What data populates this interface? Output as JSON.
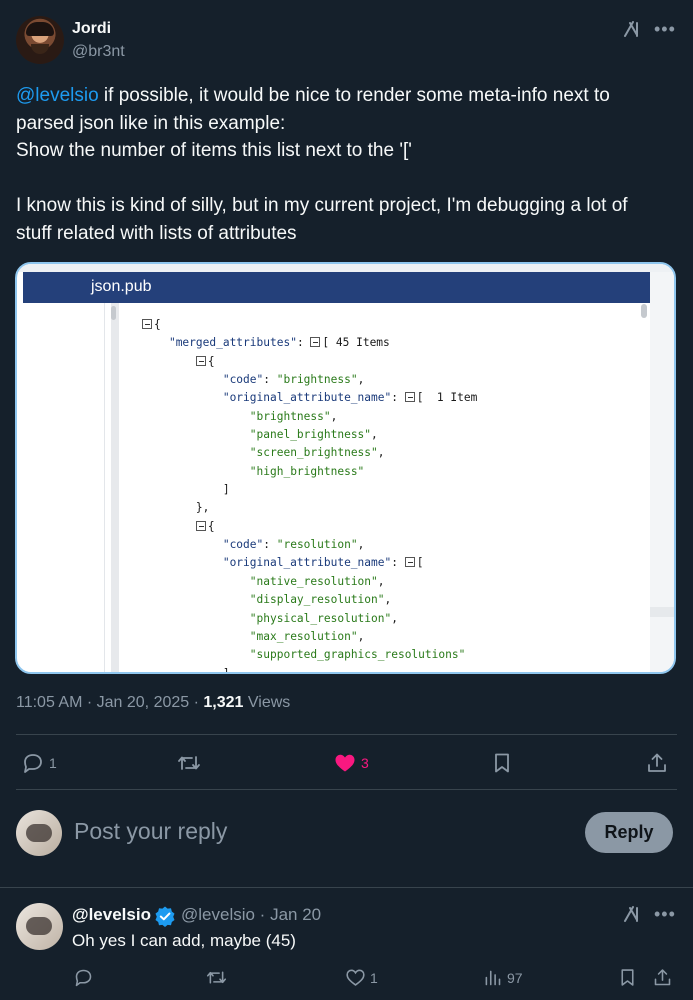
{
  "tweet": {
    "author_name": "Jordi",
    "author_handle": "@br3nt",
    "text": {
      "mention": "@levelsio",
      "line1_rest": " if possible, it would be nice to render some meta-info next to",
      "line2": "parsed json like in this example:",
      "line3": "Show the number of items this list next to the '['",
      "line4": "I know this is kind of silly, but in my current project, I'm debugging a lot of",
      "line5": "stuff related with lists of attributes"
    },
    "media": {
      "header_title": "json.pub",
      "code": {
        "open_brace": "{",
        "merged_key": "\"merged_attributes\"",
        "merged_meta": "[ 45 Items",
        "item1_open": "{",
        "code_key": "\"code\"",
        "code1_value": "\"brightness\"",
        "orig_key": "\"original_attribute_name\"",
        "orig1_meta": "[  1 Item",
        "orig1_values": [
          "\"brightness\"",
          "\"panel_brightness\"",
          "\"screen_brightness\"",
          "\"high_brightness\""
        ],
        "close_bracket": "]",
        "close_item": "},",
        "code2_value": "\"resolution\"",
        "orig2_meta": "[",
        "orig2_values": [
          "\"native_resolution\"",
          "\"display_resolution\"",
          "\"physical_resolution\"",
          "\"max_resolution\"",
          "\"supported_graphics_resolutions\""
        ]
      }
    },
    "time": "11:05 AM",
    "date": "Jan 20, 2025",
    "views_count": "1,321",
    "views_label": "Views",
    "actions": {
      "replies": "1",
      "reposts": "",
      "likes": "3"
    }
  },
  "reply_box": {
    "placeholder": "Post your reply",
    "button_label": "Reply"
  },
  "reply": {
    "author_name": "@levelsio",
    "author_handle": "@levelsio",
    "date": "Jan 20",
    "text": "Oh yes I can add, maybe (45)",
    "actions": {
      "likes": "1",
      "views": "97"
    }
  },
  "colors": {
    "background": "#15202b",
    "accent": "#1d9bf0",
    "like": "#f91880",
    "muted": "#8b98a5",
    "json_header": "#24407a"
  }
}
